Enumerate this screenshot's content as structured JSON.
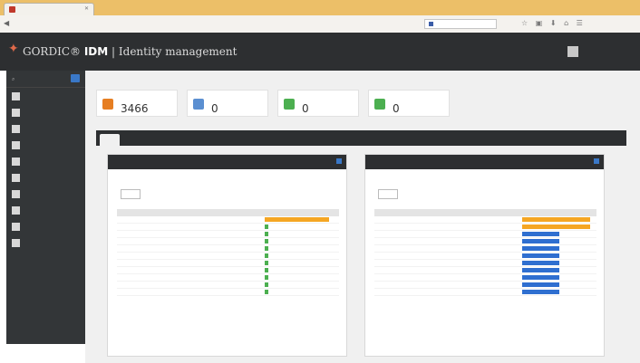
{
  "browser": {
    "tab_title": "",
    "url": "",
    "search_placeholder": ""
  },
  "app": {
    "brand": "GORDIC®",
    "brand_strong": "IDM",
    "brand_suffix": "| Identity management",
    "user_name": "",
    "user_role": ""
  },
  "sidebar": {
    "items": [
      {
        "icon": "dashboard-icon"
      },
      {
        "icon": "users-icon"
      },
      {
        "icon": "user-icon"
      },
      {
        "icon": "folder-icon"
      },
      {
        "icon": "list-icon"
      },
      {
        "icon": "tree-icon"
      },
      {
        "icon": "arrows-icon"
      },
      {
        "icon": "list-icon"
      },
      {
        "icon": "building-icon"
      },
      {
        "icon": "tools-icon"
      }
    ]
  },
  "stats": [
    {
      "label": "",
      "value": "3466",
      "color": "#e67e22"
    },
    {
      "label": "",
      "value": "0",
      "color": "#5b8fd1"
    },
    {
      "label": "",
      "value": "0",
      "color": "#4caf50"
    },
    {
      "label": "",
      "value": "0",
      "color": "#4caf50"
    }
  ],
  "tabs": [
    {
      "label": ""
    },
    {
      "label": ""
    },
    {
      "label": ""
    }
  ],
  "widgets": [
    {
      "title": "",
      "show_label": "",
      "show_value": "",
      "rows": [
        {
          "fraction": 0.95,
          "color": "#f5a623"
        },
        {
          "fraction": 0.05,
          "color": "#4caf50"
        },
        {
          "fraction": 0.05,
          "color": "#4caf50"
        },
        {
          "fraction": 0.05,
          "color": "#4caf50"
        },
        {
          "fraction": 0.05,
          "color": "#4caf50"
        },
        {
          "fraction": 0.05,
          "color": "#4caf50"
        },
        {
          "fraction": 0.05,
          "color": "#4caf50"
        },
        {
          "fraction": 0.05,
          "color": "#4caf50"
        },
        {
          "fraction": 0.05,
          "color": "#4caf50"
        },
        {
          "fraction": 0.05,
          "color": "#4caf50"
        },
        {
          "fraction": 0.05,
          "color": "#4caf50"
        }
      ]
    },
    {
      "title": "",
      "show_label": "",
      "show_value": "",
      "rows": [
        {
          "fraction": 1.0,
          "color": "#f5a623"
        },
        {
          "fraction": 1.0,
          "color": "#f5a623"
        },
        {
          "fraction": 0.55,
          "color": "#2f6fd0"
        },
        {
          "fraction": 0.55,
          "color": "#2f6fd0"
        },
        {
          "fraction": 0.55,
          "color": "#2f6fd0"
        },
        {
          "fraction": 0.55,
          "color": "#2f6fd0"
        },
        {
          "fraction": 0.55,
          "color": "#2f6fd0"
        },
        {
          "fraction": 0.55,
          "color": "#2f6fd0"
        },
        {
          "fraction": 0.55,
          "color": "#2f6fd0"
        },
        {
          "fraction": 0.55,
          "color": "#2f6fd0"
        },
        {
          "fraction": 0.55,
          "color": "#2f6fd0"
        }
      ]
    }
  ],
  "footer": ""
}
